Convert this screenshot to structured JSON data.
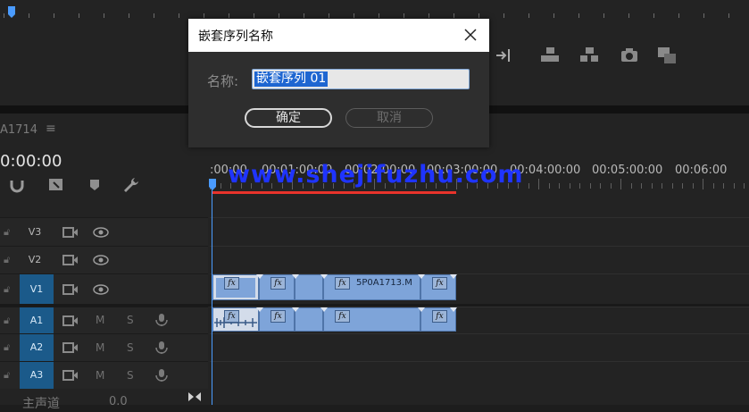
{
  "dialog": {
    "title": "嵌套序列名称",
    "name_label": "名称:",
    "name_value": "嵌套序列 01",
    "ok_label": "确定",
    "cancel_label": "取消",
    "close_icon": "close-icon"
  },
  "timeline": {
    "sequence_name": "A1714",
    "menu_icon": "≡",
    "timecode": "0:00:00",
    "ruler_labels": [
      ":00:00",
      "00:00:01:00:00",
      "00:00:02:00:00",
      "00:00:03:00:00",
      "00:04:00:00",
      "00:05:00:00",
      "00:06:00"
    ],
    "ruler_display": [
      ":00:00",
      "00:01:00:00",
      "00:02:00:00",
      "00:03:00:00",
      "00:04:00:00",
      "00:05:00:00",
      "00:06:00"
    ],
    "tracks": {
      "video": [
        "V3",
        "V2",
        "V1"
      ],
      "audio": [
        "A1",
        "A2",
        "A3"
      ]
    },
    "mute_label": "M",
    "solo_label": "S",
    "clip_name": "5P0A1713.M",
    "fx_label": "fx",
    "master_label": "主声道",
    "master_value": "0.0",
    "watermark": "www.shejifuzhu.com"
  },
  "colors": {
    "playhead": "#4a9bff",
    "work_area": "#e8332b",
    "clip": "#7ea4d9",
    "track_active": "#1b5a8a"
  }
}
